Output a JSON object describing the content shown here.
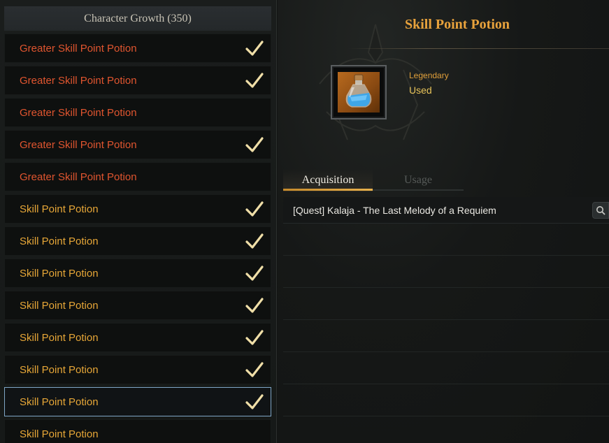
{
  "left": {
    "header": "Character Growth (350)",
    "items": [
      {
        "label": "Greater Skill Point Potion",
        "tier": "greater",
        "checked": true
      },
      {
        "label": "Greater Skill Point Potion",
        "tier": "greater",
        "checked": true
      },
      {
        "label": "Greater Skill Point Potion",
        "tier": "greater",
        "checked": false
      },
      {
        "label": "Greater Skill Point Potion",
        "tier": "greater",
        "checked": true
      },
      {
        "label": "Greater Skill Point Potion",
        "tier": "greater",
        "checked": false
      },
      {
        "label": "Skill Point Potion",
        "tier": "normal",
        "checked": true
      },
      {
        "label": "Skill Point Potion",
        "tier": "normal",
        "checked": true
      },
      {
        "label": "Skill Point Potion",
        "tier": "normal",
        "checked": true
      },
      {
        "label": "Skill Point Potion",
        "tier": "normal",
        "checked": true
      },
      {
        "label": "Skill Point Potion",
        "tier": "normal",
        "checked": true
      },
      {
        "label": "Skill Point Potion",
        "tier": "normal",
        "checked": true
      },
      {
        "label": "Skill Point Potion",
        "tier": "normal",
        "checked": true,
        "selected": true
      },
      {
        "label": "Skill Point Potion",
        "tier": "normal",
        "checked": false
      }
    ]
  },
  "detail": {
    "title": "Skill Point Potion",
    "rarity": "Legendary",
    "status": "Used",
    "icon": "potion-bottle-icon",
    "tabs": [
      {
        "label": "Acquisition",
        "active": true
      },
      {
        "label": "Usage",
        "active": false
      }
    ],
    "acquisition": [
      "[Quest] Kalaja - The Last Melody of a Requiem"
    ]
  },
  "colors": {
    "greater": "#e0552f",
    "normal": "#e6a637",
    "title": "#e8a23c",
    "check": "#f0dfa8",
    "selected_border": "#7fa6c6"
  }
}
